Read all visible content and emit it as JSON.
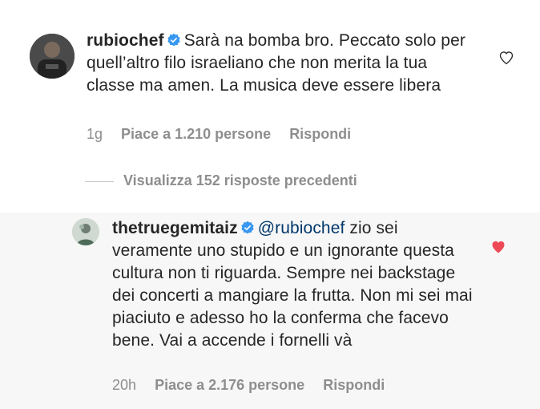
{
  "comment": {
    "username": "rubiochef",
    "text": "Sarà na bomba bro. Peccato solo per quell’altro filo israeliano che non merita la tua classe ma amen. La musica deve essere libera",
    "time": "1g",
    "likes": "Piace a 1.210 persone",
    "reply_label": "Rispondi",
    "liked": false
  },
  "view_replies": "Visualizza 152 risposte precedenti",
  "reply": {
    "username": "thetruegemitaiz",
    "mention": "@rubiochef",
    "text": "zio sei veramente uno stupido e un ignorante questa cultura non ti riguarda. Sempre nei backstage dei concerti a mangiare la frutta. Non mi sei mai piaciuto e adesso ho la conferma che facevo bene. Vai a accende i fornelli và",
    "time": "20h",
    "likes": "Piace a 2.176 persone",
    "reply_label": "Rispondi",
    "liked": true
  },
  "colors": {
    "verified": "#3897f0",
    "heart_liked": "#ed4956",
    "meta": "#8e8e8e",
    "mention": "#00376b"
  },
  "icons": [
    "verified-badge-icon",
    "heart-outline-icon",
    "heart-filled-icon",
    "avatar-icon"
  ]
}
